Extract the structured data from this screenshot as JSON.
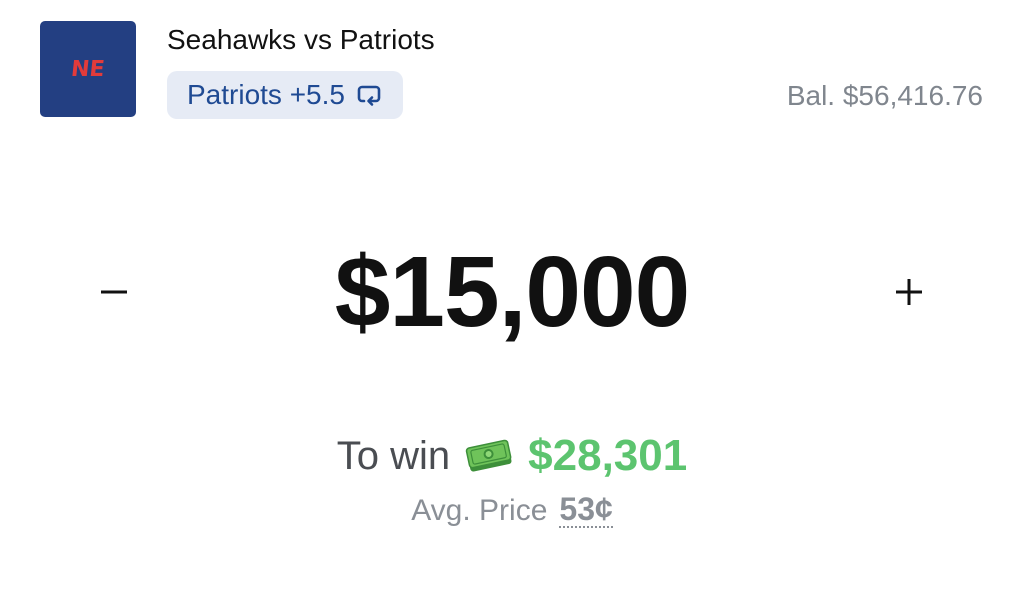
{
  "header": {
    "team_logo_text": "NE",
    "matchup": "Seahawks vs Patriots",
    "selection": "Patriots +5.5",
    "balance": "Bal. $56,416.76"
  },
  "wager": {
    "amount": "$15,000",
    "decrement_symbol": "−",
    "increment_symbol": "+"
  },
  "payout": {
    "to_win_label": "To win",
    "to_win_value": "$28,301",
    "avg_price_label": "Avg. Price",
    "avg_price_value": "53¢"
  },
  "icons": {
    "swap": "swap-icon",
    "money": "money-icon"
  },
  "colors": {
    "logo_bg": "#233f82",
    "logo_text": "#e23b3b",
    "chip_bg": "#e6ebf5",
    "chip_text": "#1f4a93",
    "to_win": "#5cc46f",
    "muted": "#80868e"
  }
}
